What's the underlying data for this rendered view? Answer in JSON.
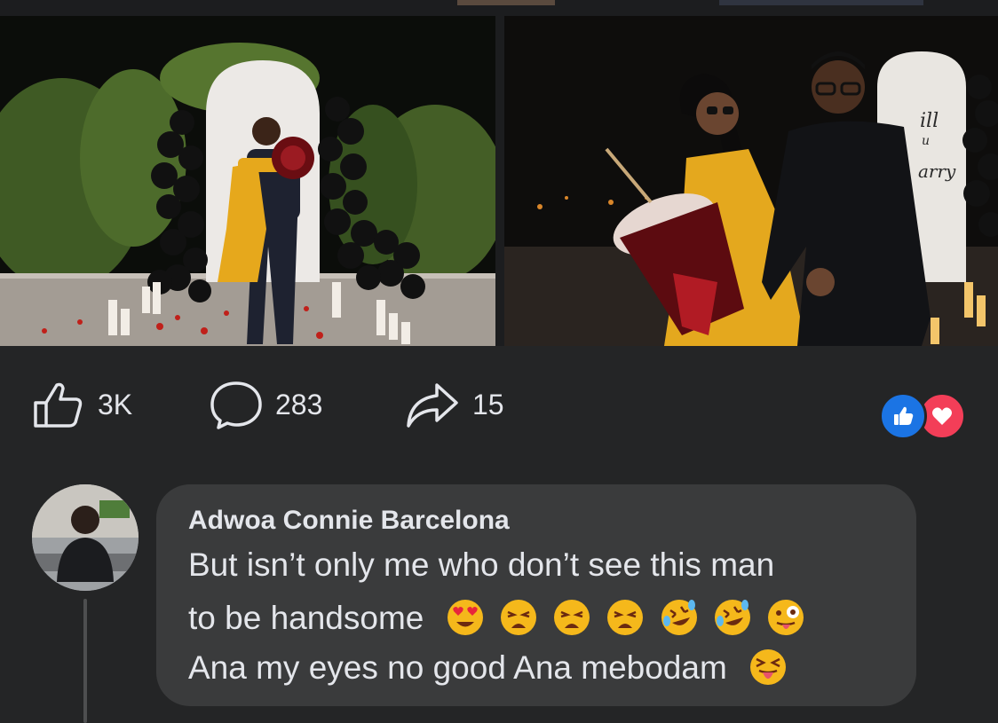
{
  "post": {
    "stats": {
      "likes": "3K",
      "comments": "283",
      "shares": "15"
    },
    "reactions": [
      "like-icon",
      "love-icon"
    ],
    "colors": {
      "like": "#1b74e4",
      "love": "#f33e58",
      "bubble": "#3a3b3c",
      "background": "#242526"
    }
  },
  "comment": {
    "author": "Adwoa Connie Barcelona",
    "line1": "But isn’t only me who don’t see this man",
    "line2": "to be handsome",
    "line2_emojis": [
      "heart-eyes-emoji",
      "weary-face-emoji",
      "weary-face-emoji",
      "weary-face-emoji",
      "rolling-laughing-emoji",
      "rolling-laughing-emoji",
      "winking-tongue-emoji"
    ],
    "line3": "Ana my eyes no good Ana mebodam",
    "line3_emojis": [
      "squinting-tongue-emoji"
    ]
  },
  "photos": {
    "left_sign": "",
    "right_sign_line1": "ill",
    "right_sign_line2": "u",
    "right_sign_line3": "arry"
  }
}
